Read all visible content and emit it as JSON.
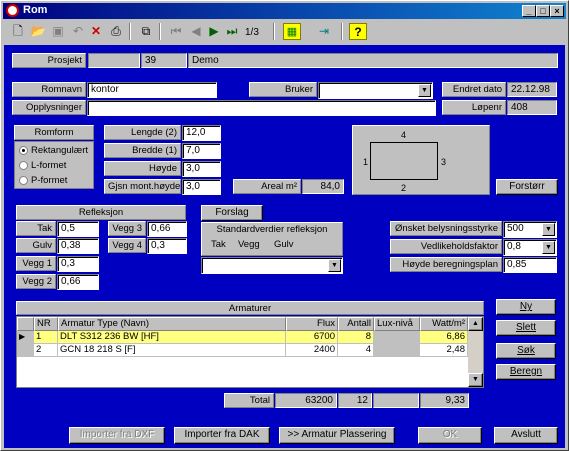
{
  "window": {
    "title": "Rom"
  },
  "toolbar": {
    "page_indicator": "1/3"
  },
  "project": {
    "label": "Prosjekt",
    "number": "39",
    "name": "Demo"
  },
  "room": {
    "name_label": "Romnavn",
    "name_value": "kontor",
    "info_label": "Opplysninger",
    "info_value": "",
    "user_label": "Bruker",
    "user_value": "",
    "changed_label": "Endret dato",
    "changed_value": "22.12.98",
    "serial_label": "Løpenr",
    "serial_value": "408"
  },
  "shape": {
    "title": "Romform",
    "options": [
      "Rektangulært",
      "L-formet",
      "P-formet"
    ],
    "selected": "Rektangulært"
  },
  "dimensions": {
    "length_label": "Lengde (2)",
    "length_value": "12,0",
    "width_label": "Bredde (1)",
    "width_value": "7,0",
    "height_label": "Høyde",
    "height_value": "3,0",
    "mount_label": "Gjsn mont.høyde",
    "mount_value": "3,0",
    "area_label": "Areal m²",
    "area_value": "84,0"
  },
  "diagram": {
    "side_top": "4",
    "side_left": "1",
    "side_right": "3",
    "side_bottom": "2",
    "zoom_button": "Forstørr"
  },
  "reflection": {
    "title": "Refleksjon",
    "ceiling_label": "Tak",
    "ceiling_value": "0,5",
    "floor_label": "Gulv",
    "floor_value": "0,38",
    "wall1_label": "Vegg 1",
    "wall1_value": "0,3",
    "wall2_label": "Vegg 2",
    "wall2_value": "0,66",
    "wall3_label": "Vegg 3",
    "wall3_value": "0,66",
    "wall4_label": "Vegg 4",
    "wall4_value": "0,3",
    "suggest_button": "Forslag",
    "std_title": "Standardverdier refleksjon",
    "std_cols": [
      "Tak",
      "Vegg",
      "Gulv"
    ],
    "std_value": ""
  },
  "lighting": {
    "desired_label": "Ønsket belysningsstyrke",
    "desired_value": "500",
    "maint_label": "Vedlikeholdsfaktor",
    "maint_value": "0,8",
    "calc_height_label": "Høyde beregningsplan",
    "calc_height_value": "0,85"
  },
  "fixtures": {
    "title": "Armaturer",
    "columns": [
      "NR",
      "Armatur Type (Navn)",
      "Flux",
      "Antall",
      "Lux-nivå",
      "Watt/m²"
    ],
    "rows": [
      {
        "nr": "1",
        "type": "DLT S312 236 BW  [HF]",
        "flux": "6700",
        "count": "8",
        "lux": "",
        "watt": "6,86"
      },
      {
        "nr": "2",
        "type": "GCN 18 218 S  [F]",
        "flux": "2400",
        "count": "4",
        "lux": "",
        "watt": "2,48"
      }
    ],
    "total_label": "Total",
    "total_flux": "63200",
    "total_count": "12",
    "total_lux": "",
    "total_watt": "9,33"
  },
  "side_buttons": {
    "new": "Ny",
    "delete": "Slett",
    "search": "Søk",
    "calc": "Beregn"
  },
  "bottom_buttons": {
    "import_dxf": "Importer fra DXF",
    "import_dak": "Importer fra DAK",
    "placement": ">> Armatur Plassering",
    "ok": "OK",
    "cancel": "Avslutt"
  },
  "colors": {
    "background": "#0000c0",
    "selected_row": "#ffff80",
    "title_start": "#000080",
    "title_end": "#1084d0"
  }
}
